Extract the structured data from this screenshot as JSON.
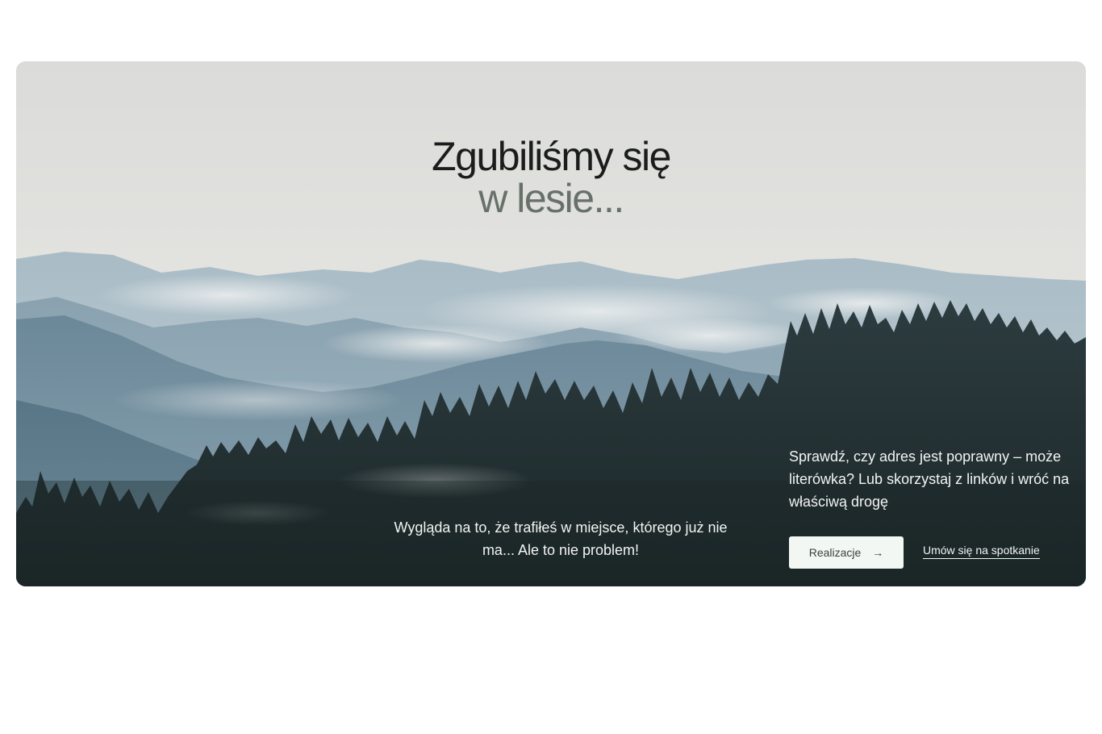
{
  "headline": {
    "line1": "Zgubiliśmy się",
    "line2": "w lesie..."
  },
  "center_text": "Wygląda na to, że trafiłeś w miejsce, którego już nie ma... Ale to nie problem!",
  "side_text": "Sprawdź, czy adres jest poprawny – może literówka? Lub skorzystaj z linków i wróć na właściwą drogę",
  "actions": {
    "primary_label": "Realizacje",
    "primary_icon": "arrow-right-icon",
    "secondary_label": "Umów się na spotkanie"
  },
  "colors": {
    "headline_dark": "#1a1d1c",
    "headline_muted": "#67716a",
    "button_bg": "#f2f7f4",
    "text_light": "#f2f4f3"
  }
}
